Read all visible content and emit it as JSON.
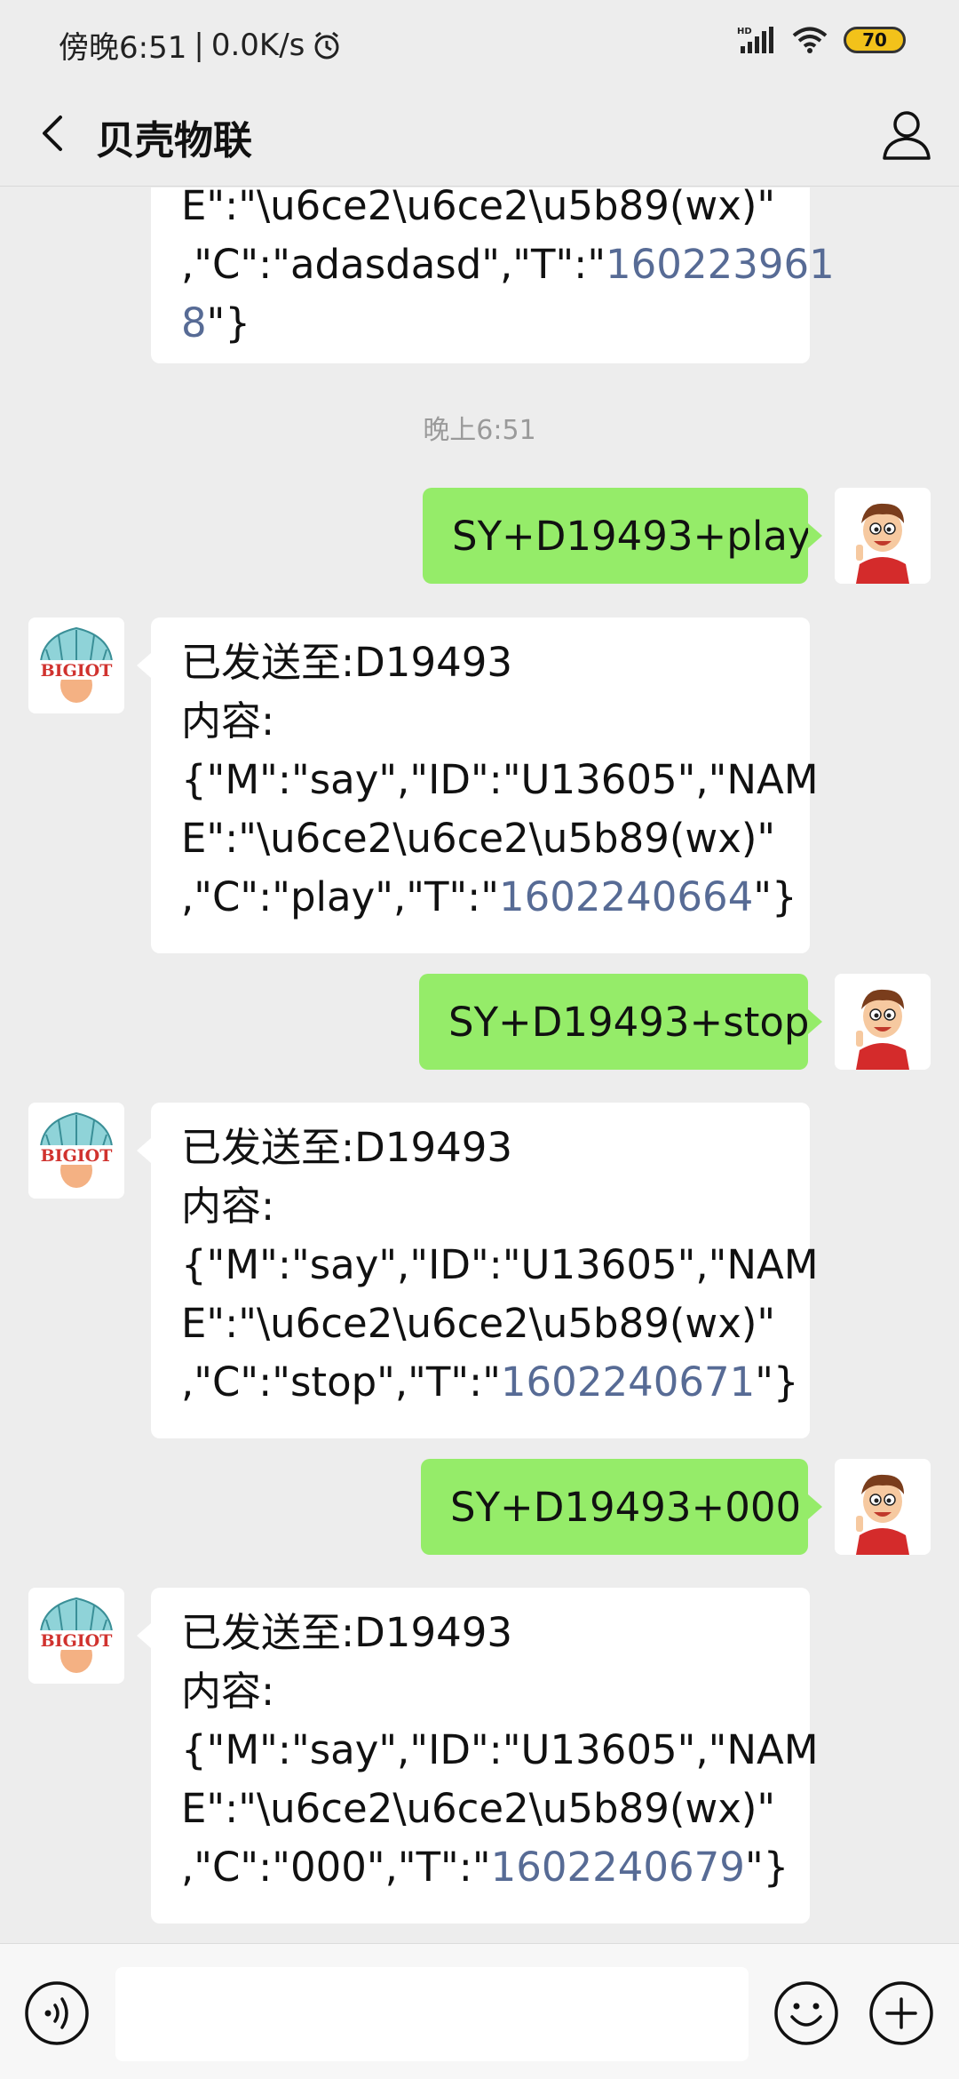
{
  "status_bar": {
    "time": "傍晚6:51",
    "network_speed": "0.0K/s",
    "separator": "|",
    "hd_label": "HD",
    "battery": "70"
  },
  "header": {
    "title": "贝壳物联"
  },
  "messages": {
    "m0": {
      "lines": [
        "E\":\"\\u6ce2\\u6ce2\\u5b89(wx)\"",
        ",\"C\":\"adasdasd\",\"T\":\""
      ],
      "timestamp_a": "160223961",
      "timestamp_b": "8",
      "tail": "\"}"
    },
    "time_divider": "晚上6:51",
    "m1": {
      "text": "SY+D19493+play"
    },
    "m2": {
      "l1": "已发送至:D19493",
      "l2": "内容:",
      "l3": "{\"M\":\"say\",\"ID\":\"U13605\",\"NAM",
      "l4": "E\":\"\\u6ce2\\u6ce2\\u5b89(wx)\"",
      "l5_pre": ",\"C\":\"play\",\"T\":\"",
      "timestamp": "1602240664",
      "l5_post": "\"}"
    },
    "m3": {
      "text": "SY+D19493+stop"
    },
    "m4": {
      "l1": "已发送至:D19493",
      "l2": "内容:",
      "l3": "{\"M\":\"say\",\"ID\":\"U13605\",\"NAM",
      "l4": "E\":\"\\u6ce2\\u6ce2\\u5b89(wx)\"",
      "l5_pre": ",\"C\":\"stop\",\"T\":\"",
      "timestamp": "1602240671",
      "l5_post": "\"}"
    },
    "m5": {
      "text": "SY+D19493+000"
    },
    "m6": {
      "l1": "已发送至:D19493",
      "l2": "内容:",
      "l3": "{\"M\":\"say\",\"ID\":\"U13605\",\"NAM",
      "l4": "E\":\"\\u6ce2\\u6ce2\\u5b89(wx)\"",
      "l5_pre": ",\"C\":\"000\",\"T\":\"",
      "timestamp": "1602240679",
      "l5_post": "\"}"
    }
  },
  "bot_avatar": {
    "logo_text": "BIGIOT"
  },
  "input_bar": {
    "value": "",
    "icons": [
      "voice-icon",
      "emoji-icon",
      "plus-icon"
    ]
  },
  "colors": {
    "outgoing_bubble": "#95ec69",
    "incoming_bubble": "#ffffff",
    "link_number": "#576b95",
    "background": "#ededed"
  }
}
